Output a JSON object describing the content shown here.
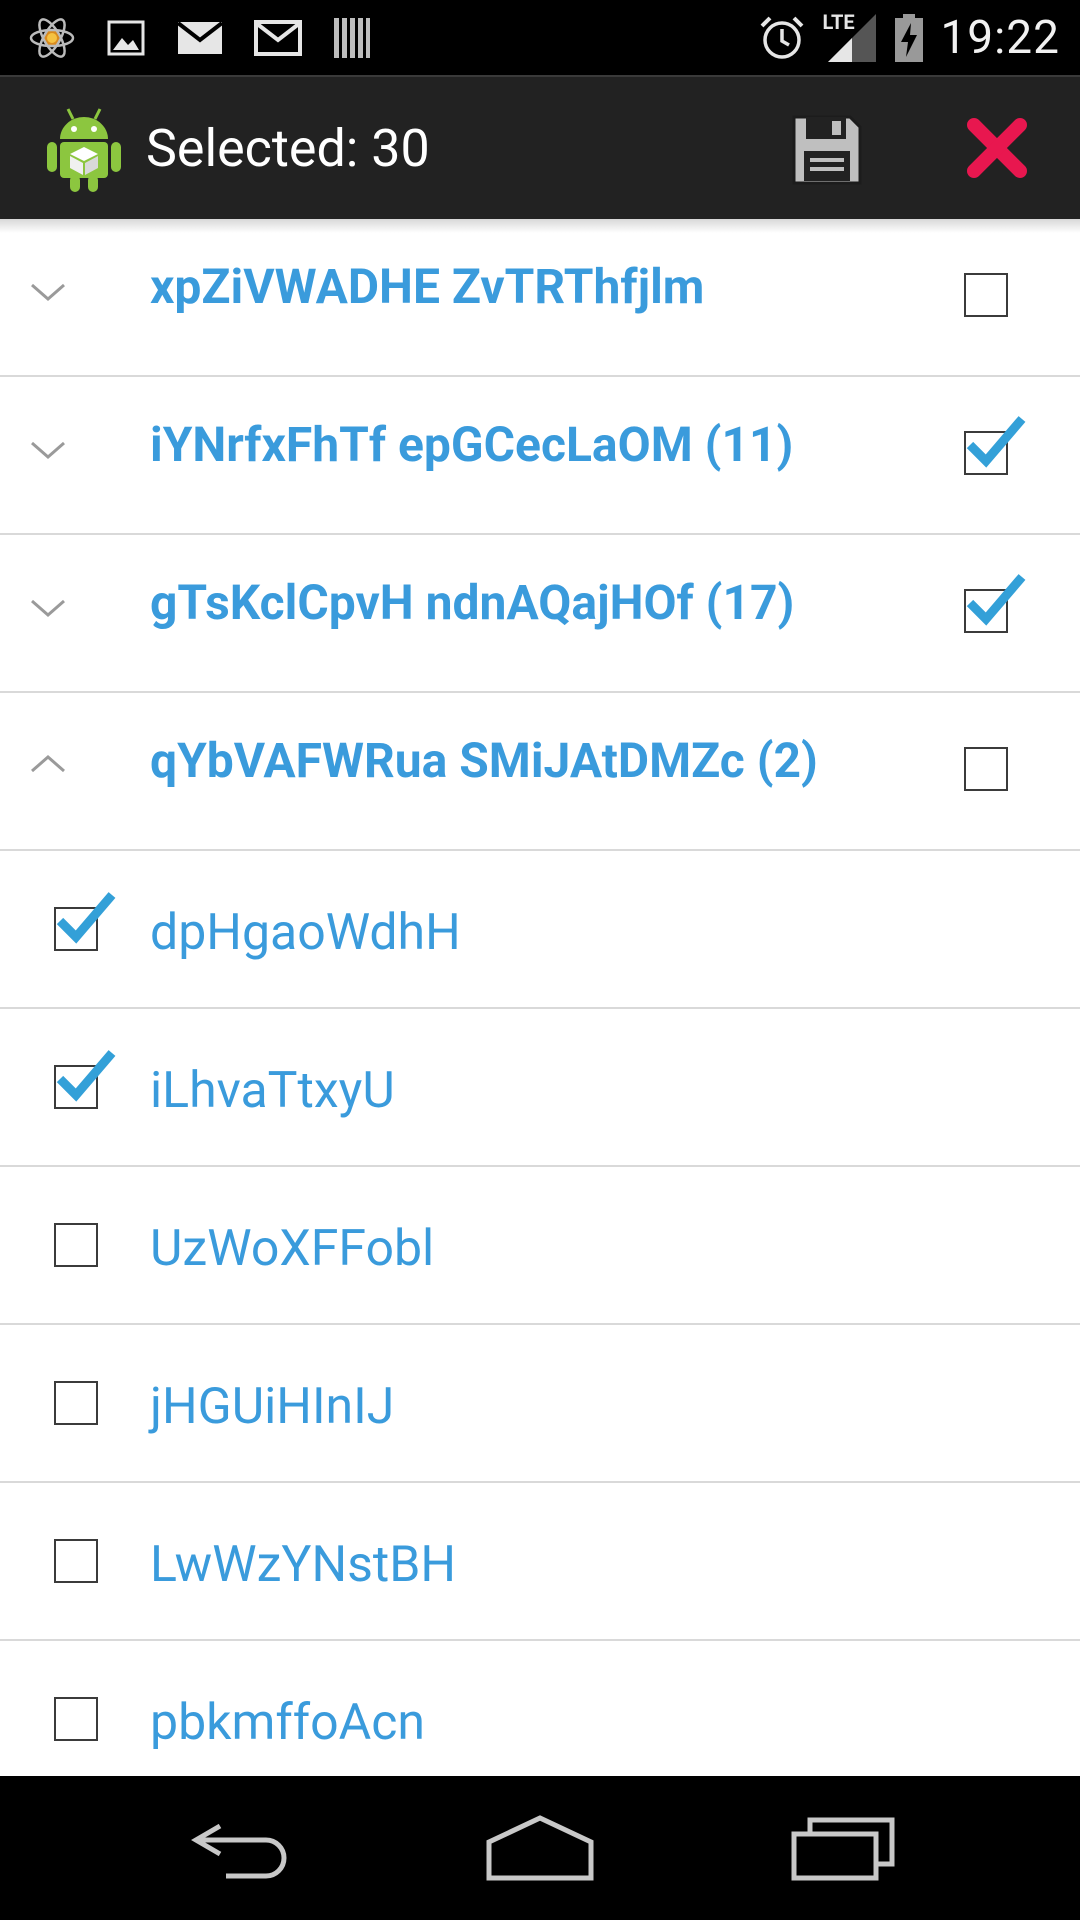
{
  "status_bar": {
    "time": "19:22",
    "network_label": "LTE",
    "left_icons": [
      "atom-app-icon",
      "image-icon",
      "gmail-icon",
      "gmail-icon",
      "barcode-icon"
    ],
    "right_icons": [
      "alarm-icon",
      "lte-signal-icon",
      "battery-charging-icon"
    ]
  },
  "action_bar": {
    "title": "Selected: 30",
    "app_icon": "android-robot-icon",
    "actions": [
      "save-icon",
      "close-icon"
    ],
    "close_color": "#e8174f"
  },
  "groups": [
    {
      "label": "xpZiVWADHE ZvTRThfjlm",
      "expanded": false,
      "checked": false
    },
    {
      "label": "iYNrfxFhTf epGCecLaOM (11)",
      "expanded": false,
      "checked": true
    },
    {
      "label": "gTsKclCpvH ndnAQajHOf (17)",
      "expanded": false,
      "checked": true
    },
    {
      "label": "qYbVAFWRua SMiJAtDMZc (2)",
      "expanded": true,
      "checked": false
    }
  ],
  "items": [
    {
      "label": "dpHgaoWdhH",
      "checked": true
    },
    {
      "label": "iLhvaTtxyU",
      "checked": true
    },
    {
      "label": "UzWoXFFobl",
      "checked": false
    },
    {
      "label": "jHGUiHInIJ",
      "checked": false
    },
    {
      "label": "LwWzYNstBH",
      "checked": false
    },
    {
      "label": "pbkmffoAcn",
      "checked": false
    }
  ],
  "colors": {
    "accent": "#3a9bdc",
    "action_bar_bg": "#222222",
    "divider": "#d9d9d9"
  },
  "nav_bar": [
    "back-icon",
    "home-icon",
    "recent-apps-icon"
  ]
}
